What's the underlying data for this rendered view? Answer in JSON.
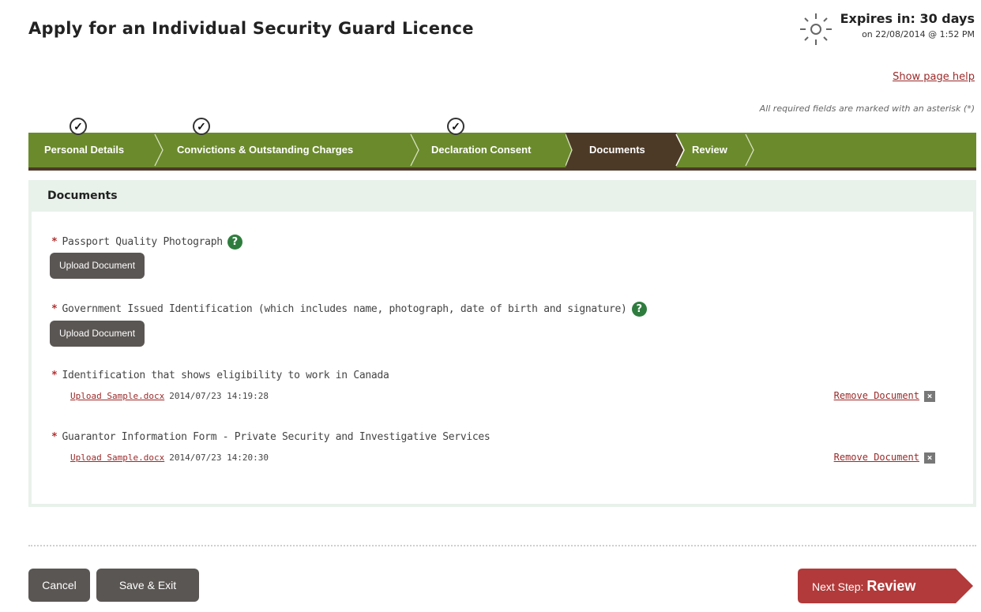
{
  "header": {
    "title": "Apply for an Individual Security Guard Licence",
    "expires_main": "Expires in: 30 days",
    "expires_sub": "on 22/08/2014 @ 1:52 PM",
    "page_help": "Show page help",
    "required_note": "All required fields are marked with an asterisk (*)"
  },
  "steps": [
    {
      "label": "Personal Details",
      "completed": true
    },
    {
      "label": "Convictions & Outstanding Charges",
      "completed": true
    },
    {
      "label": "Declaration Consent",
      "completed": true
    },
    {
      "label": "Documents",
      "active": true
    },
    {
      "label": "Review"
    }
  ],
  "panel": {
    "title": "Documents",
    "fields": [
      {
        "label": "Passport Quality Photograph",
        "has_help": true,
        "upload_label": "Upload Document"
      },
      {
        "label": "Government Issued Identification (which includes name, photograph, date of birth and signature)",
        "has_help": true,
        "upload_label": "Upload Document"
      },
      {
        "label": "Identification that shows eligibility to work in Canada",
        "file": "Upload Sample.docx",
        "timestamp": "2014/07/23 14:19:28",
        "remove_label": "Remove Document"
      },
      {
        "label": "Guarantor Information Form - Private Security and Investigative Services",
        "file": "Upload Sample.docx",
        "timestamp": "2014/07/23 14:20:30",
        "remove_label": "Remove Document"
      }
    ]
  },
  "footer": {
    "cancel": "Cancel",
    "save_exit": "Save & Exit",
    "next_prefix": "Next Step:",
    "next_step": "Review"
  },
  "colors": {
    "step_bar": "#6b8a2c",
    "step_active": "#4d3a26",
    "button_dark": "#5a5653",
    "next_button": "#b23a3a",
    "link": "#9b2a2a",
    "help_icon": "#2e7d3e"
  },
  "icons": {
    "expiry": "sun-clock-icon",
    "help": "question-circle-icon",
    "remove": "close-box-icon",
    "check": "checkmark-icon"
  }
}
